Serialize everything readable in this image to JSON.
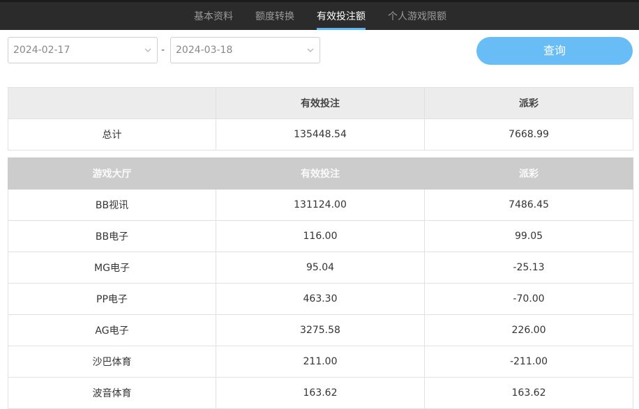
{
  "nav": {
    "tabs": [
      {
        "label": "基本资料"
      },
      {
        "label": "额度转换"
      },
      {
        "label": "有效投注额"
      },
      {
        "label": "个人游戏限额"
      }
    ],
    "active_index": 2
  },
  "filters": {
    "start_date": "2024-02-17",
    "end_date": "2024-03-18",
    "separator": "-",
    "query_label": "查询"
  },
  "summary": {
    "headers": [
      "",
      "有效投注",
      "派彩"
    ],
    "row": {
      "label": "总计",
      "valid_bet": "135448.54",
      "payout": "7668.99"
    }
  },
  "detail": {
    "headers": [
      "游戏大厅",
      "有效投注",
      "派彩"
    ],
    "rows": [
      {
        "hall": "BB视讯",
        "valid_bet": "131124.00",
        "payout": "7486.45"
      },
      {
        "hall": "BB电子",
        "valid_bet": "116.00",
        "payout": "99.05"
      },
      {
        "hall": "MG电子",
        "valid_bet": "95.04",
        "payout": "-25.13"
      },
      {
        "hall": "PP电子",
        "valid_bet": "463.30",
        "payout": "-70.00"
      },
      {
        "hall": "AG电子",
        "valid_bet": "3275.58",
        "payout": "226.00"
      },
      {
        "hall": "沙巴体育",
        "valid_bet": "211.00",
        "payout": "-211.00"
      },
      {
        "hall": "波音体育",
        "valid_bet": "163.62",
        "payout": "163.62"
      }
    ]
  },
  "colors": {
    "accent": "#5cb6f5",
    "button": "#68bdf6",
    "topbar": "#2b2b2b"
  }
}
